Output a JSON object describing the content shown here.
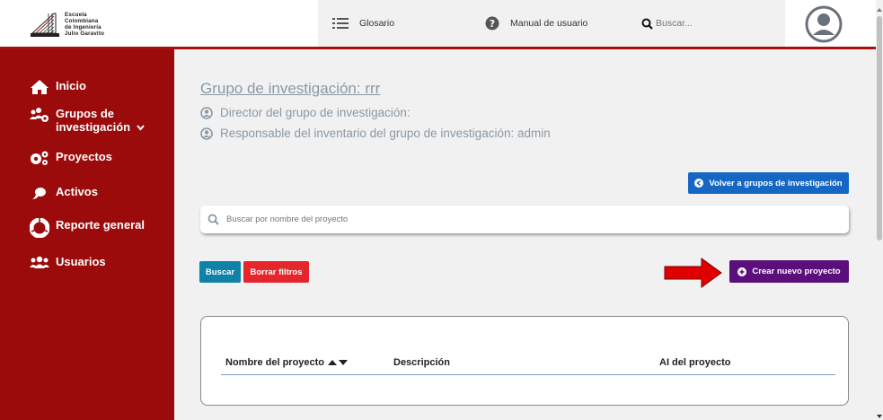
{
  "header": {
    "logo_lines": [
      "Escuela",
      "Colombiana",
      "de Ingeniería",
      "Julio Garavito"
    ],
    "nav": [
      {
        "label": "Glosario",
        "icon": "list-icon"
      },
      {
        "label": "Manual de usuario",
        "icon": "help-icon"
      }
    ],
    "search_placeholder": "Buscar...",
    "avatar_icon": "user-circle-icon"
  },
  "sidebar": {
    "items": [
      {
        "label": "Inicio",
        "icon": "home-icon"
      },
      {
        "label": "Grupos de investigación",
        "icon": "users-cog-icon"
      },
      {
        "label": "Proyectos",
        "icon": "cogs-icon"
      },
      {
        "label": "Activos",
        "icon": "pepper-icon"
      },
      {
        "label": "Reporte general",
        "icon": "chart-donut-icon"
      },
      {
        "label": "Usuarios",
        "icon": "users-icon"
      }
    ]
  },
  "main": {
    "title": "Grupo de investigación: rrr",
    "director_label": "Director del grupo de investigación:",
    "responsable_label": "Responsable del inventario del grupo de investigación: admin",
    "volver_button": "Volver a grupos de investigación",
    "search_placeholder": "Buscar por nombre del proyecto",
    "buscar_button": "Buscar",
    "borrar_button": "Borrar filtros",
    "crear_button": "Crear nuevo proyecto",
    "table": {
      "columns": [
        "Nombre del proyecto",
        "Descripción",
        "AI del proyecto"
      ]
    }
  },
  "colors": {
    "brand_red": "#9b0b0b",
    "volver_blue": "#1667c4",
    "buscar_teal": "#1082a8",
    "borrar_red": "#e5262c",
    "crear_purple": "#5a0f7a",
    "muted_text": "#8a99a6"
  }
}
